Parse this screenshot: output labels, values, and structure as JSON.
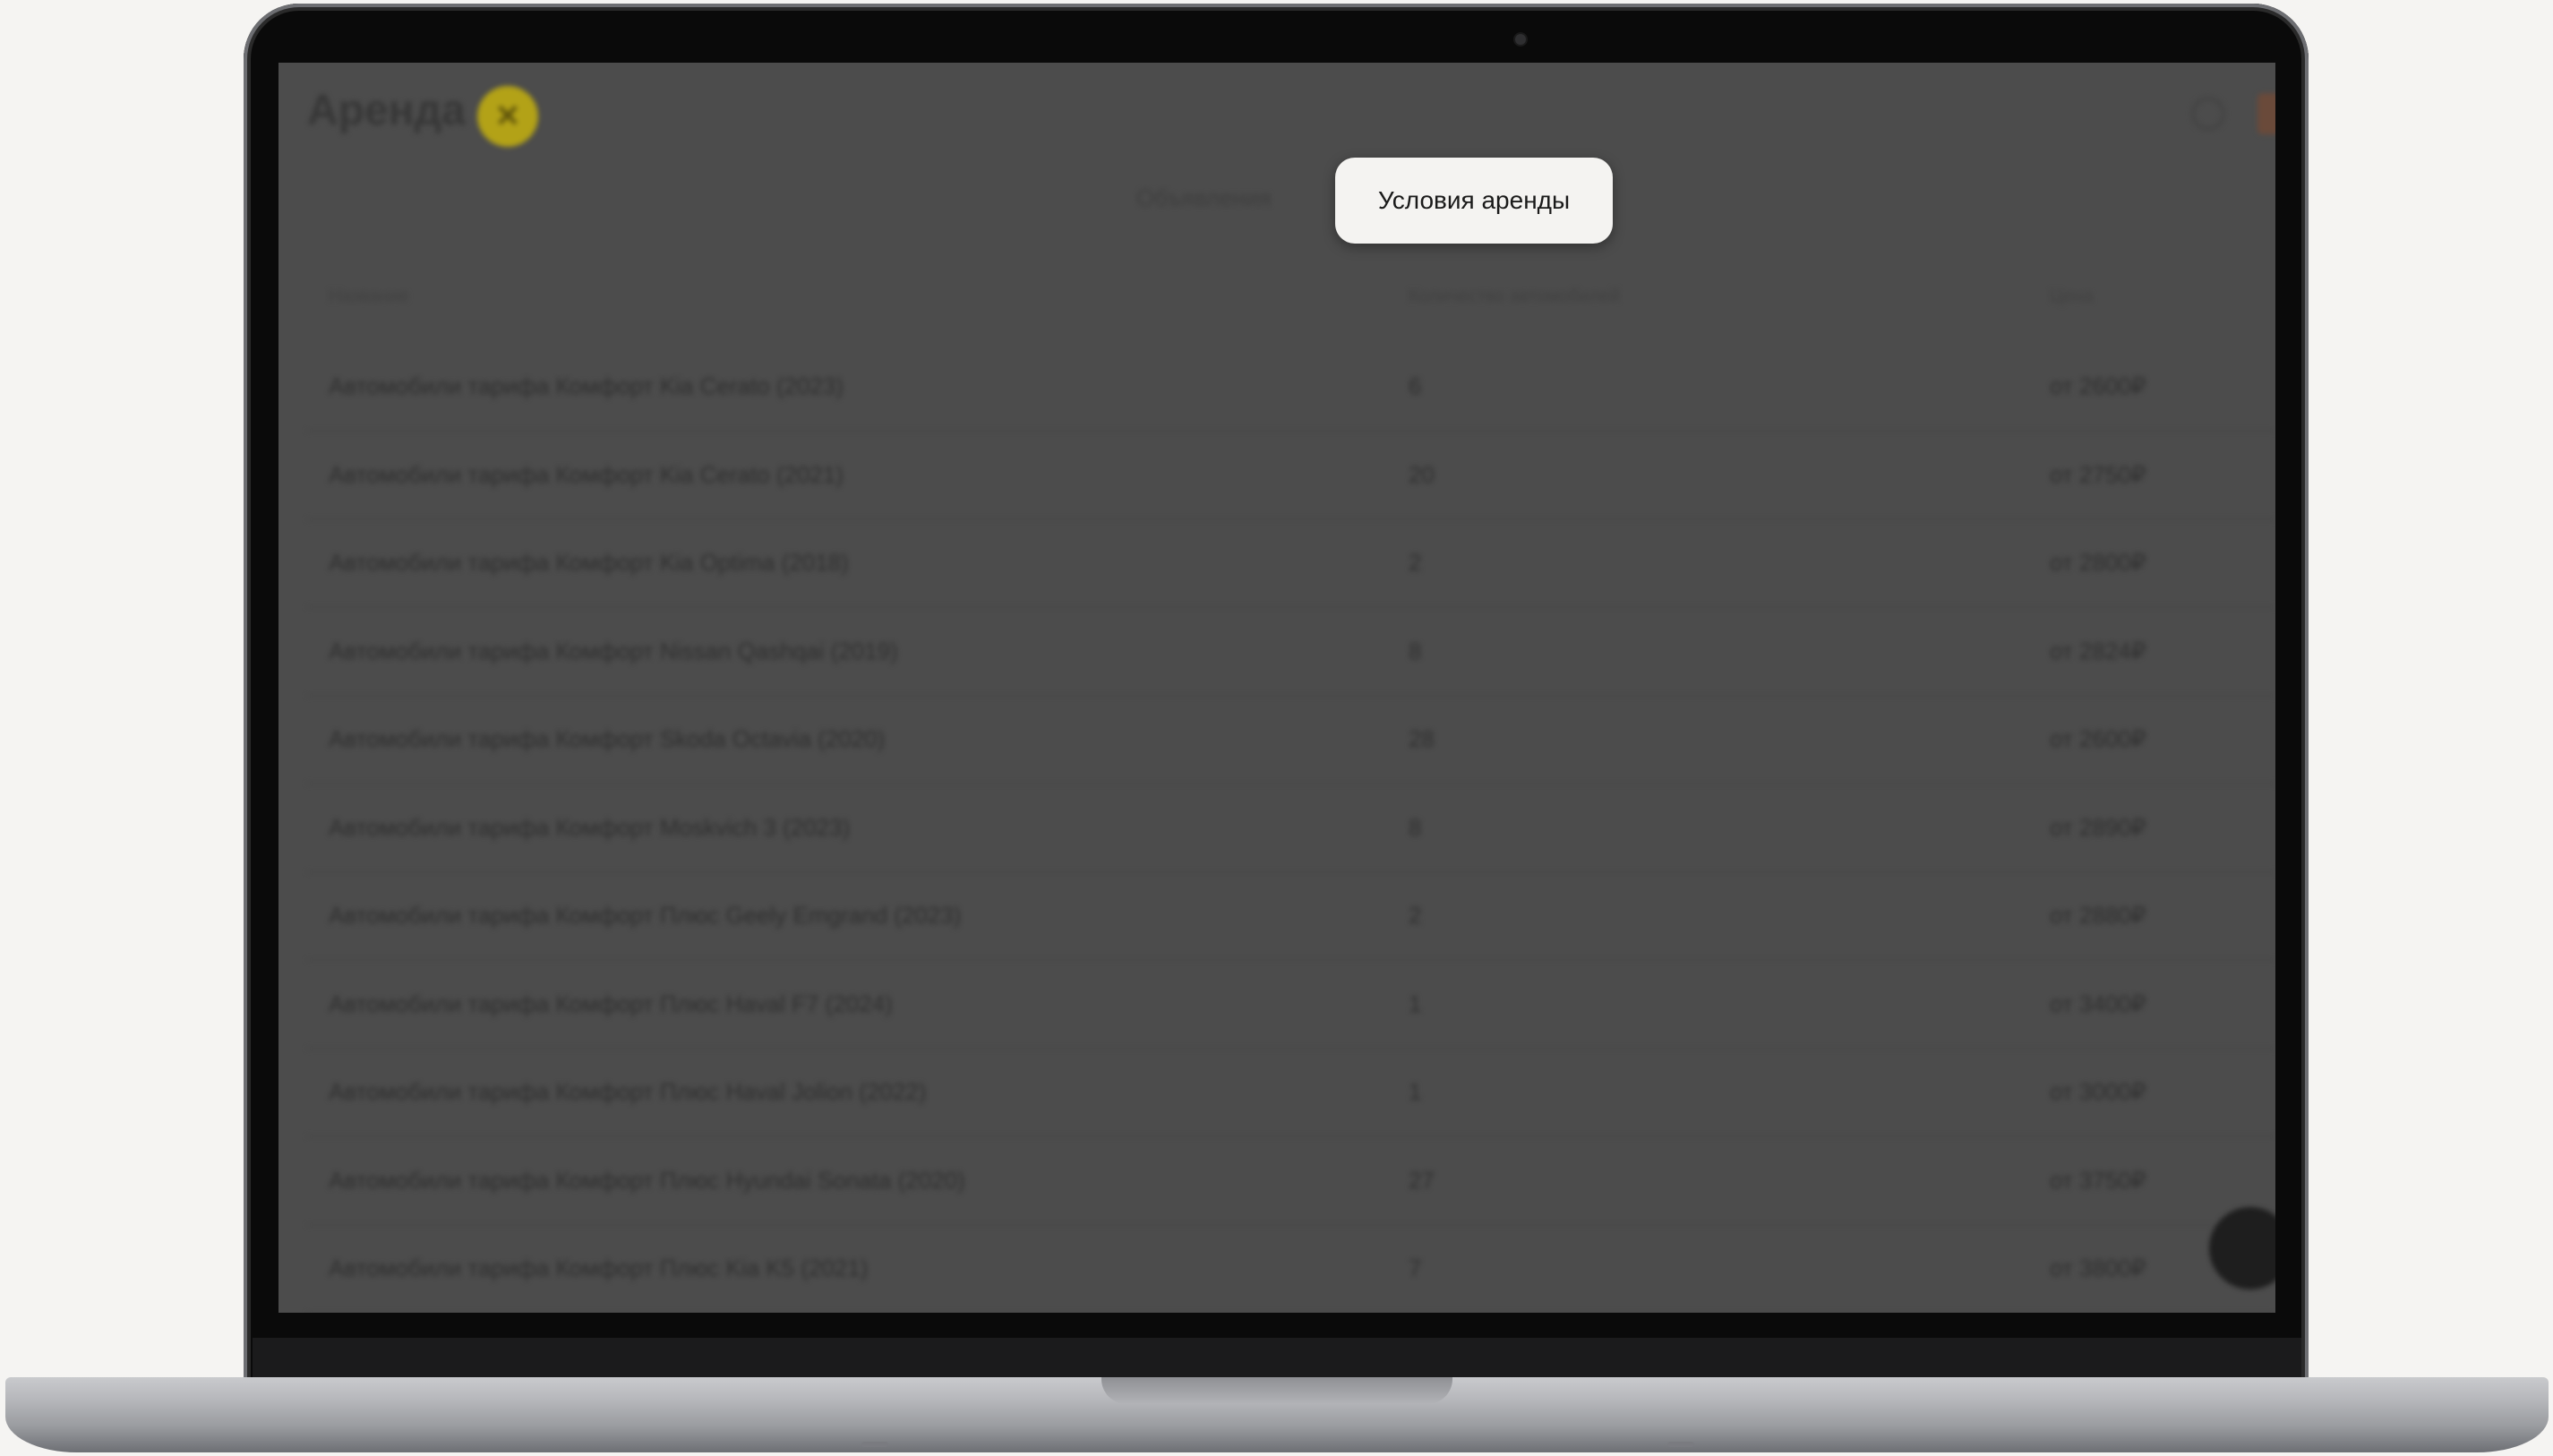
{
  "app": {
    "title": "Аренда",
    "logo_glyph": "✕"
  },
  "tabs": [
    {
      "label": "Объявления",
      "active": false
    },
    {
      "label": "Условия аренды",
      "active": true
    }
  ],
  "table": {
    "headers": [
      "Название",
      "Количество автомобилей",
      "Цена"
    ],
    "rows": [
      {
        "name": "Автомобили тарифа Комфорт Kia Cerato (2023)",
        "count": "6",
        "price": "от 2600₽"
      },
      {
        "name": "Автомобили тарифа Комфорт Kia Cerato (2021)",
        "count": "20",
        "price": "от 2750₽"
      },
      {
        "name": "Автомобили тарифа Комфорт Kia Optima (2018)",
        "count": "2",
        "price": "от 2800₽"
      },
      {
        "name": "Автомобили тарифа Комфорт Nissan Qashqai (2019)",
        "count": "8",
        "price": "от 2824₽"
      },
      {
        "name": "Автомобили тарифа Комфорт Skoda Octavia (2020)",
        "count": "28",
        "price": "от 2600₽"
      },
      {
        "name": "Автомобили тарифа Комфорт Moskvich 3 (2023)",
        "count": "8",
        "price": "от 2890₽"
      },
      {
        "name": "Автомобили тарифа Комфорт Плюс Geely Emgrand (2023)",
        "count": "2",
        "price": "от 2880₽"
      },
      {
        "name": "Автомобили тарифа Комфорт Плюс Haval F7 (2024)",
        "count": "1",
        "price": "от 3400₽"
      },
      {
        "name": "Автомобили тарифа Комфорт Плюс Haval Jolion (2022)",
        "count": "1",
        "price": "от 3000₽"
      },
      {
        "name": "Автомобили тарифа Комфорт Плюс Hyundai Sonata (2020)",
        "count": "27",
        "price": "от 3750₽"
      },
      {
        "name": "Автомобили тарифа Комфорт Плюс Kia K5 (2021)",
        "count": "7",
        "price": "от 3800₽"
      }
    ]
  },
  "icons": {
    "search": "search-icon",
    "avatar": "avatar",
    "chat": "chat-icon"
  }
}
